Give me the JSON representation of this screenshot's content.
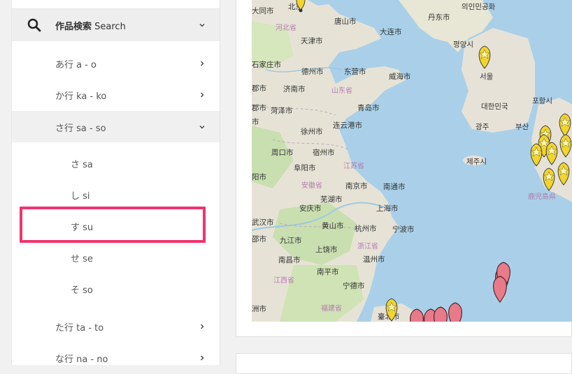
{
  "sidebar": {
    "search": {
      "label_jp": "作品検索",
      "label_en": "Search"
    },
    "items": [
      {
        "label": "あ行 a - o"
      },
      {
        "label": "か行 ka - ko"
      },
      {
        "label": "さ行 sa - so"
      },
      {
        "label": "た行 ta - to"
      },
      {
        "label": "な行 na - no"
      }
    ],
    "subitems": [
      {
        "label": "さ sa"
      },
      {
        "label": "し si"
      },
      {
        "label": "す su"
      },
      {
        "label": "せ se"
      },
      {
        "label": "そ so"
      }
    ]
  },
  "map": {
    "labels": {
      "datong": "大同市",
      "beijing": "北京",
      "hebei": "河北省",
      "tangshan": "唐山市",
      "dalian": "大连市",
      "dandong": "丹东市",
      "nk_hospital": "의인민공화",
      "tianjin": "天津市",
      "pyongyang": "평양시",
      "shijiazhuang": "石家庄市",
      "dezhou": "德州市",
      "dongying": "东营市",
      "weihai": "威海市",
      "seoul": "서울",
      "jinan": "济南市",
      "shandong": "山东省",
      "korea": "대한민국",
      "pohang": "포항시",
      "heze": "菏泽市",
      "qingdao": "青岛市",
      "gwangju": "광주",
      "busan": "부산",
      "xuzhou": "徐州市",
      "lianyungang": "连云港市",
      "zhoukou": "周口市",
      "suqian": "宿州市",
      "jeju": "제주시",
      "fuyang": "阜阳市",
      "jiangsu": "江苏省",
      "anhui": "安徽省",
      "nanjing": "南京市",
      "nantong": "南通市",
      "anqing": "安庆市",
      "wuhu": "芜湖市",
      "shanghai": "上海市",
      "kagoshima": "鹿児島県",
      "wuhan": "武汉市",
      "huangshan": "黄山市",
      "hangzhou": "杭州市",
      "ningbo": "宁波市",
      "jiujiang": "九江市",
      "zhejiang": "浙江省",
      "shangrao": "上饶市",
      "nanchang": "南昌市",
      "wenzhou": "温州市",
      "jiangxi": "江西省",
      "nanping": "南平市",
      "ningde": "宁德市",
      "fujian": "福建省",
      "taiwan": "臺北市",
      "yanzhou": "洲市",
      "yangshi": "阳市",
      "fushi": "邵市",
      "tushi": "郡市",
      "chishi": "市"
    }
  }
}
